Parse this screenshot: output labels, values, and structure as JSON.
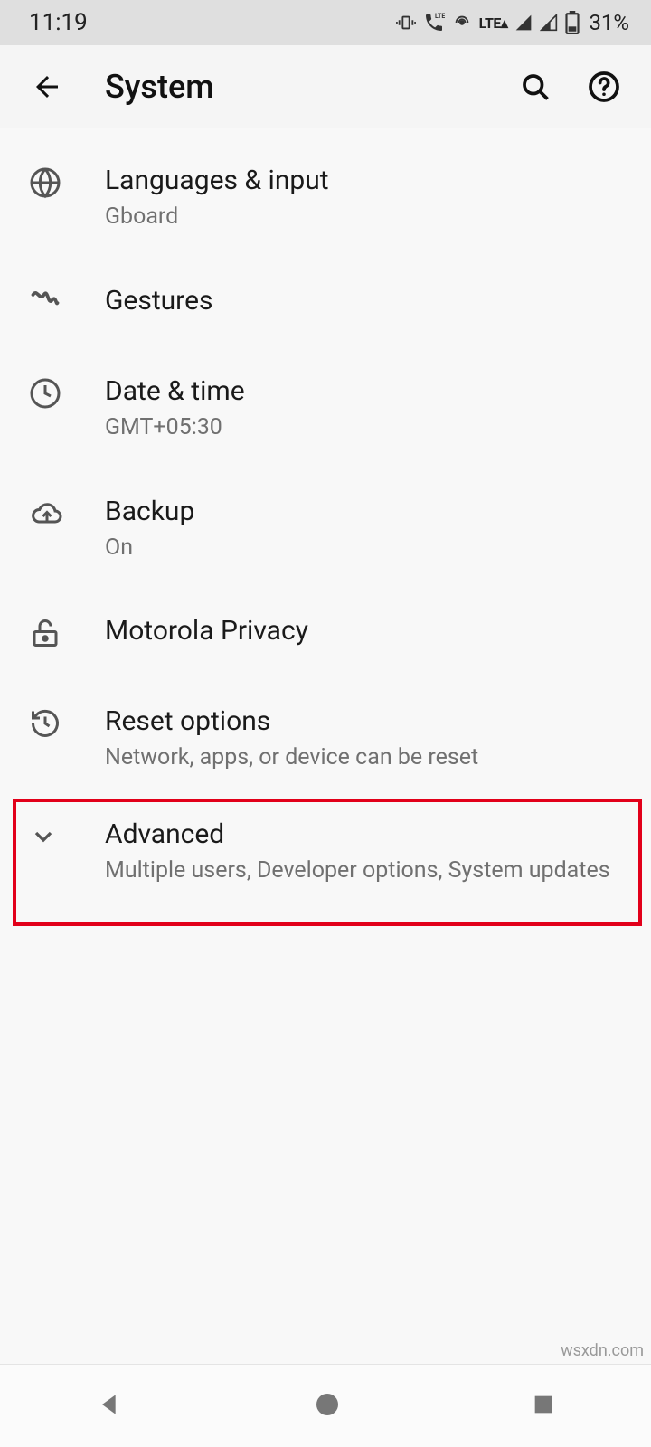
{
  "status": {
    "time": "11:19",
    "lte_label": "LTE",
    "lte_arrow": "▴",
    "battery": "31%"
  },
  "header": {
    "title": "System"
  },
  "items": [
    {
      "title": "Languages & input",
      "subtitle": "Gboard"
    },
    {
      "title": "Gestures",
      "subtitle": ""
    },
    {
      "title": "Date & time",
      "subtitle": "GMT+05:30"
    },
    {
      "title": "Backup",
      "subtitle": "On"
    },
    {
      "title": "Motorola Privacy",
      "subtitle": ""
    },
    {
      "title": "Reset options",
      "subtitle": "Network, apps, or device can be reset"
    },
    {
      "title": "Advanced",
      "subtitle": "Multiple users, Developer options, System updates"
    }
  ],
  "watermark": "wsxdn.com"
}
